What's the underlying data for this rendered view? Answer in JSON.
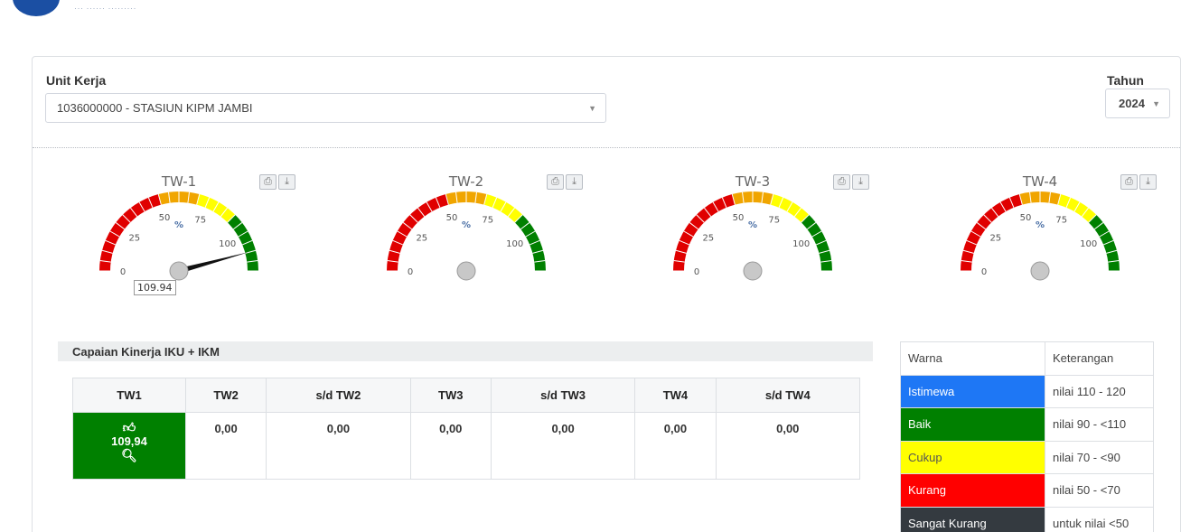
{
  "header": {
    "logo_subtitle": "··· ······ ·········"
  },
  "filters": {
    "unit_label": "Unit Kerja",
    "unit_value": "1036000000 - STASIUN KIPM JAMBI",
    "year_label": "Tahun",
    "year_value": "2024"
  },
  "gauges": [
    {
      "title": "TW-1",
      "value": 109.94,
      "value_label": "109.94",
      "show_value": true
    },
    {
      "title": "TW-2",
      "value": 0,
      "value_label": "",
      "show_value": false
    },
    {
      "title": "TW-3",
      "value": 0,
      "value_label": "",
      "show_value": false
    },
    {
      "title": "TW-4",
      "value": 0,
      "value_label": "",
      "show_value": false
    }
  ],
  "gauge_scale": {
    "ticks": [
      "0",
      "25",
      "50",
      "75",
      "100"
    ],
    "unit": "%",
    "max": 120
  },
  "gauge_bands": [
    {
      "from": 0,
      "to": 50,
      "color": "#e00000"
    },
    {
      "from": 50,
      "to": 70,
      "color": "#f0a500"
    },
    {
      "from": 70,
      "to": 90,
      "color": "#ffff00"
    },
    {
      "from": 90,
      "to": 120,
      "color": "#008000"
    }
  ],
  "capaian": {
    "title": "Capaian Kinerja IKU + IKM",
    "columns": [
      "TW1",
      "TW2",
      "s/d TW2",
      "TW3",
      "s/d TW3",
      "TW4",
      "s/d TW4"
    ],
    "values": [
      "109,94",
      "0,00",
      "0,00",
      "0,00",
      "0,00",
      "0,00",
      "0,00"
    ],
    "tw1_icon": "thumbs-up-icon",
    "tw1_action_icon": "search-icon"
  },
  "legend": {
    "header_color": "Warna",
    "header_desc": "Keterangan",
    "rows": [
      {
        "label": "Istimewa",
        "desc": "nilai 110 - 120",
        "color": "#1e77f5"
      },
      {
        "label": "Baik",
        "desc": "nilai 90 - <110",
        "color": "#008000"
      },
      {
        "label": "Cukup",
        "desc": "nilai 70 - <90",
        "color": "#ffff00"
      },
      {
        "label": "Kurang",
        "desc": "nilai 50 - <70",
        "color": "#ff0000"
      },
      {
        "label": "Sangat Kurang",
        "desc": "untuk nilai <50",
        "color": "#343a40"
      }
    ]
  }
}
